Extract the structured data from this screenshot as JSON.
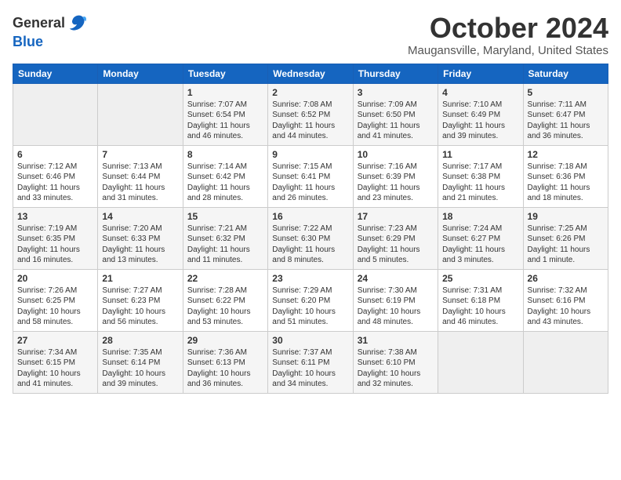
{
  "header": {
    "logo_line1": "General",
    "logo_line2": "Blue",
    "month_title": "October 2024",
    "location": "Maugansville, Maryland, United States"
  },
  "days_of_week": [
    "Sunday",
    "Monday",
    "Tuesday",
    "Wednesday",
    "Thursday",
    "Friday",
    "Saturday"
  ],
  "weeks": [
    [
      {
        "day": "",
        "info": ""
      },
      {
        "day": "",
        "info": ""
      },
      {
        "day": "1",
        "info": "Sunrise: 7:07 AM\nSunset: 6:54 PM\nDaylight: 11 hours and 46 minutes."
      },
      {
        "day": "2",
        "info": "Sunrise: 7:08 AM\nSunset: 6:52 PM\nDaylight: 11 hours and 44 minutes."
      },
      {
        "day": "3",
        "info": "Sunrise: 7:09 AM\nSunset: 6:50 PM\nDaylight: 11 hours and 41 minutes."
      },
      {
        "day": "4",
        "info": "Sunrise: 7:10 AM\nSunset: 6:49 PM\nDaylight: 11 hours and 39 minutes."
      },
      {
        "day": "5",
        "info": "Sunrise: 7:11 AM\nSunset: 6:47 PM\nDaylight: 11 hours and 36 minutes."
      }
    ],
    [
      {
        "day": "6",
        "info": "Sunrise: 7:12 AM\nSunset: 6:46 PM\nDaylight: 11 hours and 33 minutes."
      },
      {
        "day": "7",
        "info": "Sunrise: 7:13 AM\nSunset: 6:44 PM\nDaylight: 11 hours and 31 minutes."
      },
      {
        "day": "8",
        "info": "Sunrise: 7:14 AM\nSunset: 6:42 PM\nDaylight: 11 hours and 28 minutes."
      },
      {
        "day": "9",
        "info": "Sunrise: 7:15 AM\nSunset: 6:41 PM\nDaylight: 11 hours and 26 minutes."
      },
      {
        "day": "10",
        "info": "Sunrise: 7:16 AM\nSunset: 6:39 PM\nDaylight: 11 hours and 23 minutes."
      },
      {
        "day": "11",
        "info": "Sunrise: 7:17 AM\nSunset: 6:38 PM\nDaylight: 11 hours and 21 minutes."
      },
      {
        "day": "12",
        "info": "Sunrise: 7:18 AM\nSunset: 6:36 PM\nDaylight: 11 hours and 18 minutes."
      }
    ],
    [
      {
        "day": "13",
        "info": "Sunrise: 7:19 AM\nSunset: 6:35 PM\nDaylight: 11 hours and 16 minutes."
      },
      {
        "day": "14",
        "info": "Sunrise: 7:20 AM\nSunset: 6:33 PM\nDaylight: 11 hours and 13 minutes."
      },
      {
        "day": "15",
        "info": "Sunrise: 7:21 AM\nSunset: 6:32 PM\nDaylight: 11 hours and 11 minutes."
      },
      {
        "day": "16",
        "info": "Sunrise: 7:22 AM\nSunset: 6:30 PM\nDaylight: 11 hours and 8 minutes."
      },
      {
        "day": "17",
        "info": "Sunrise: 7:23 AM\nSunset: 6:29 PM\nDaylight: 11 hours and 5 minutes."
      },
      {
        "day": "18",
        "info": "Sunrise: 7:24 AM\nSunset: 6:27 PM\nDaylight: 11 hours and 3 minutes."
      },
      {
        "day": "19",
        "info": "Sunrise: 7:25 AM\nSunset: 6:26 PM\nDaylight: 11 hours and 1 minute."
      }
    ],
    [
      {
        "day": "20",
        "info": "Sunrise: 7:26 AM\nSunset: 6:25 PM\nDaylight: 10 hours and 58 minutes."
      },
      {
        "day": "21",
        "info": "Sunrise: 7:27 AM\nSunset: 6:23 PM\nDaylight: 10 hours and 56 minutes."
      },
      {
        "day": "22",
        "info": "Sunrise: 7:28 AM\nSunset: 6:22 PM\nDaylight: 10 hours and 53 minutes."
      },
      {
        "day": "23",
        "info": "Sunrise: 7:29 AM\nSunset: 6:20 PM\nDaylight: 10 hours and 51 minutes."
      },
      {
        "day": "24",
        "info": "Sunrise: 7:30 AM\nSunset: 6:19 PM\nDaylight: 10 hours and 48 minutes."
      },
      {
        "day": "25",
        "info": "Sunrise: 7:31 AM\nSunset: 6:18 PM\nDaylight: 10 hours and 46 minutes."
      },
      {
        "day": "26",
        "info": "Sunrise: 7:32 AM\nSunset: 6:16 PM\nDaylight: 10 hours and 43 minutes."
      }
    ],
    [
      {
        "day": "27",
        "info": "Sunrise: 7:34 AM\nSunset: 6:15 PM\nDaylight: 10 hours and 41 minutes."
      },
      {
        "day": "28",
        "info": "Sunrise: 7:35 AM\nSunset: 6:14 PM\nDaylight: 10 hours and 39 minutes."
      },
      {
        "day": "29",
        "info": "Sunrise: 7:36 AM\nSunset: 6:13 PM\nDaylight: 10 hours and 36 minutes."
      },
      {
        "day": "30",
        "info": "Sunrise: 7:37 AM\nSunset: 6:11 PM\nDaylight: 10 hours and 34 minutes."
      },
      {
        "day": "31",
        "info": "Sunrise: 7:38 AM\nSunset: 6:10 PM\nDaylight: 10 hours and 32 minutes."
      },
      {
        "day": "",
        "info": ""
      },
      {
        "day": "",
        "info": ""
      }
    ]
  ]
}
